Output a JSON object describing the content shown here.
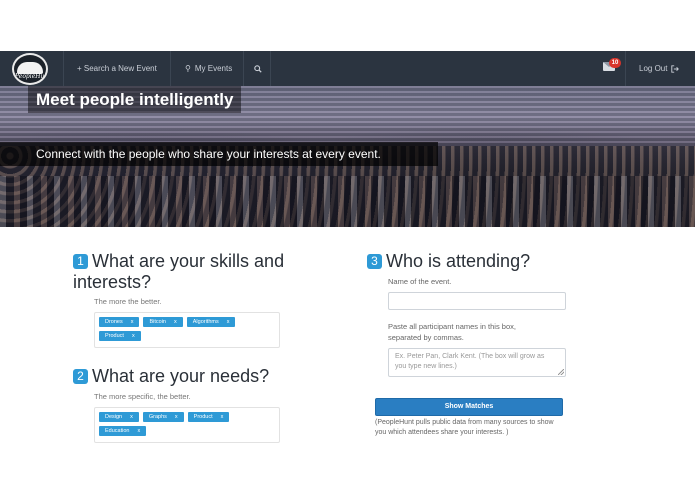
{
  "logo": {
    "text": "PeopleHunt"
  },
  "nav": {
    "search_event": "+ Search a New Event",
    "my_events": "My Events",
    "search_icon": "search-icon",
    "mail_badge": "10",
    "logout": "Log Out"
  },
  "hero": {
    "title": "Meet people intelligently",
    "subtitle": "Connect with the people who share your interests at every event."
  },
  "skills": {
    "number": "1",
    "title_line1": "What are your skills and",
    "title_line2": "interests?",
    "hint": "The more the better.",
    "tags": [
      "Drones",
      "Bitcoin",
      "Algorithms",
      "Product"
    ]
  },
  "needs": {
    "number": "2",
    "title": "What are your needs?",
    "hint": "The more specific, the better.",
    "tags": [
      "Design",
      "Graphs",
      "Product",
      "Education"
    ]
  },
  "attending": {
    "number": "3",
    "title": "Who is attending?",
    "event_label": "Name of the event.",
    "event_value": "",
    "paste_label_line1": "Paste all participant names in this box,",
    "paste_label_line2": "separated by commas.",
    "textarea_placeholder_line1": "Ex. Peter Pan, Clark Kent. (The box will grow as",
    "textarea_placeholder_line2": "you type new lines.)",
    "button": "Show Matches",
    "note_line1": "(PeopleHunt pulls public data from many sources to show",
    "note_line2": "you which attendees share your interests. )"
  },
  "tag_remove": "x",
  "colors": {
    "navbar": "#2b3440",
    "accent": "#2e9ad6",
    "button": "#2a7ec2"
  }
}
